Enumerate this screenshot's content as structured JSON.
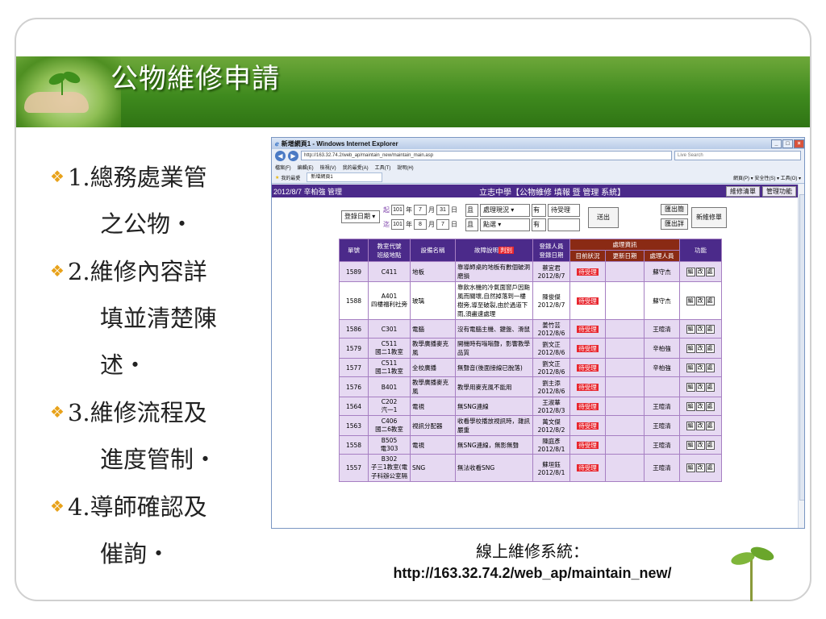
{
  "slide": {
    "title": "公物維修申請",
    "bullets": [
      {
        "num": "1.總務處業管",
        "cont": "之公物・"
      },
      {
        "num": "2.維修內容詳",
        "cont": "填並清楚陳",
        "cont2": "述・"
      },
      {
        "num": "3.維修流程及",
        "cont": "進度管制・"
      },
      {
        "num": "4.導師確認及",
        "cont": "催詢・"
      }
    ],
    "footer_line1": "線上維修系統：",
    "footer_line2": "http://163.32.74.2/web_ap/maintain_new/"
  },
  "browser": {
    "title": "新增網頁1 - Windows Internet Explorer",
    "url": "http://163.32.74.2/web_ap/maintain_new/maintain_main.asp",
    "search_placeholder": "Live Search",
    "menu": [
      "檔案(F)",
      "編輯(E)",
      "檢視(V)",
      "我的最愛(A)",
      "工具(T)",
      "說明(H)"
    ],
    "favorites": "我的最愛",
    "tab": "新增網頁1",
    "tools": "網頁(P) ▾  安全性(S) ▾  工具(O) ▾"
  },
  "app": {
    "date_user": "2012/8/7  辛柏強  管理",
    "system_title": "立志中學【公物維修 填報 暨 管理 系統】",
    "header_buttons": [
      "維修清單",
      "管理功能"
    ],
    "filters": {
      "date_type": "登錄日期",
      "from_label": "起",
      "from_year": "101",
      "from_month": "7",
      "from_day": "31",
      "to_label": "迄",
      "to_year": "101",
      "to_month": "8",
      "to_day": "7",
      "year_unit": "年",
      "month_unit": "月",
      "day_unit": "日",
      "cond1_op": "且",
      "cond1_field": "處理現況",
      "cond1_rel": "有",
      "cond1_value": "待受理",
      "cond2_op": "且",
      "cond2_field": "點選",
      "cond2_rel": "有",
      "submit": "送出",
      "export_brief": "匯出簡",
      "export_detail": "匯出詳",
      "add_new": "新維修單"
    },
    "table": {
      "headers": {
        "id": "單號",
        "room": "教室代號\n班級地點",
        "device": "設備名稱",
        "desc": "故障說明",
        "desc_badge": "判別",
        "reporter": "登錄人員\n登錄日期",
        "proc_group": "處理資訊",
        "status": "目前狀況",
        "update": "更新日期",
        "handler": "處理人員",
        "fn": "功能"
      },
      "fn_labels": [
        "編",
        "改",
        "處"
      ],
      "rows": [
        {
          "id": "1589",
          "room": "C411",
          "device": "地板",
          "desc": "靠導師桌的地板有數個破洞磨損",
          "reporter": "蔡宜君\n2012/8/7",
          "status": "待受理",
          "update": "",
          "handler": "蘇守杰"
        },
        {
          "id": "1588",
          "room": "A401\n四樓福利社旁",
          "device": "玻璃",
          "desc": "靠飲水機的冷氣面窗戶因颱風而關壞,自然掉落到一樓樹旁,導至破裂,由於過道下雨,須盡速處理",
          "reporter": "陳俊傑\n2012/8/7",
          "status": "待受理",
          "update": "",
          "handler": "蘇守杰"
        },
        {
          "id": "1586",
          "room": "C301",
          "device": "電腦",
          "desc": "沒有電腦主機、鍵盤、滑鼠",
          "reporter": "姜竹芸\n2012/8/6",
          "status": "待受理",
          "update": "",
          "handler": "王暄清"
        },
        {
          "id": "1579",
          "room": "C511\n國二1教室",
          "device": "教學廣播麥克風",
          "desc": "開機時有嗡嗡聲，影響教學品質",
          "reporter": "劉文正\n2012/8/6",
          "status": "待受理",
          "update": "",
          "handler": "辛柏強"
        },
        {
          "id": "1577",
          "room": "C511\n國二1教室",
          "device": "全校廣播",
          "desc": "無聲音(後面接線已脫落)",
          "reporter": "劉文正\n2012/8/6",
          "status": "待受理",
          "update": "",
          "handler": "辛柏強"
        },
        {
          "id": "1576",
          "room": "B401",
          "device": "教學廣播麥克風",
          "desc": "教學用麥克風不能用",
          "reporter": "劉主添\n2012/8/6",
          "status": "待受理",
          "update": "",
          "handler": ""
        },
        {
          "id": "1564",
          "room": "C202\n汽一1",
          "device": "電視",
          "desc": "無SNG連線",
          "reporter": "王淑華\n2012/8/3",
          "status": "待受理",
          "update": "",
          "handler": "王暄清"
        },
        {
          "id": "1563",
          "room": "C406\n國二6教室",
          "device": "視訊分配器",
          "desc": "收看學校播放視訊時，雜訊嚴重",
          "reporter": "萬文傑\n2012/8/2",
          "status": "待受理",
          "update": "",
          "handler": "王暄清"
        },
        {
          "id": "1558",
          "room": "B505\n電303",
          "device": "電視",
          "desc": "無SNG連線，無影無聲",
          "reporter": "陳庭彥\n2012/8/1",
          "status": "待受理",
          "update": "",
          "handler": "王暄清"
        },
        {
          "id": "1557",
          "room": "B302\n子三1教室(電子科辦公室隔",
          "device": "SNG",
          "desc": "無法收看SNG",
          "reporter": "蘇垣鈺\n2012/8/1",
          "status": "待受理",
          "update": "",
          "handler": "王暄清"
        }
      ]
    }
  }
}
